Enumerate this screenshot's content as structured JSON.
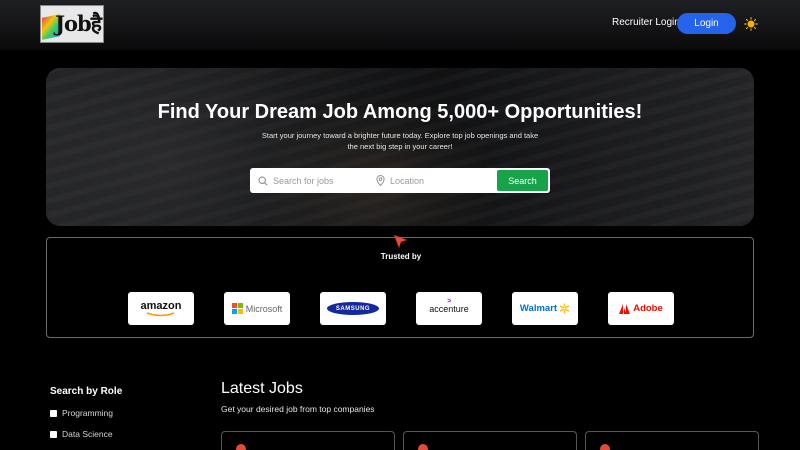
{
  "header": {
    "logo_text": "Jobहै",
    "recruiter_login": "Recruiter Login",
    "login": "Login",
    "theme_icon": "sun-icon"
  },
  "hero": {
    "title": "Find Your Dream Job Among 5,000+ Opportunities!",
    "subtitle": "Start your journey toward a brighter future today. Explore top job openings and take the next big step in your career!",
    "search_placeholder": "Search for jobs",
    "location_placeholder": "Location",
    "search_button": "Search"
  },
  "trusted": {
    "title": "Trusted by",
    "brands": [
      "amazon",
      "Microsoft",
      "SAMSUNG",
      "accenture",
      "Walmart",
      "Adobe"
    ]
  },
  "sidebar": {
    "title": "Search by Role",
    "roles": [
      "Programming",
      "Data Science"
    ]
  },
  "latest": {
    "title": "Latest Jobs",
    "subtitle": "Get your desired job from top companies"
  },
  "colors": {
    "accent_blue": "#2563eb",
    "search_green": "#16a34a",
    "cursor_red": "#e74c3c"
  }
}
